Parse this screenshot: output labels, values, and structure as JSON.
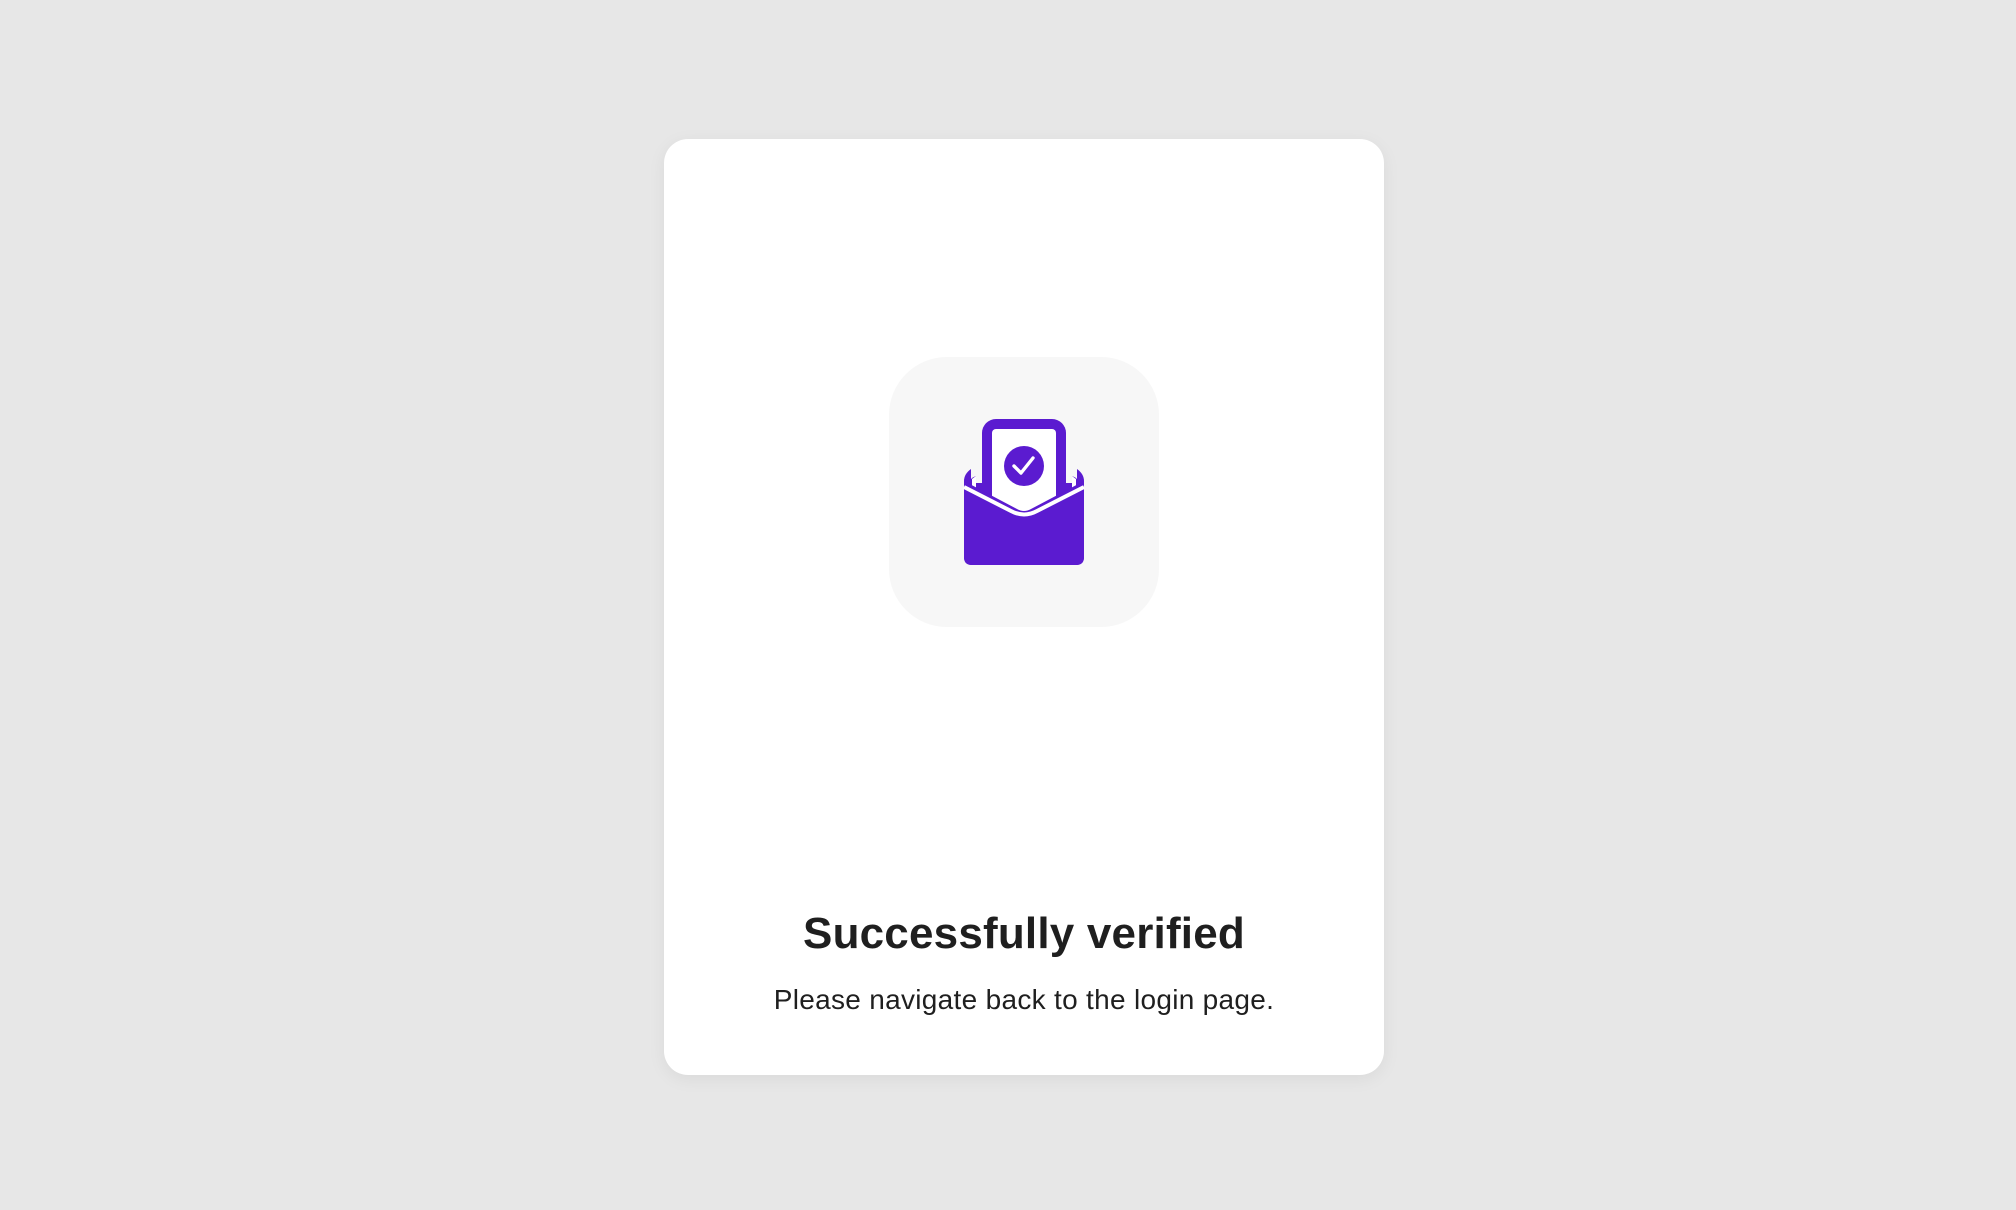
{
  "status": {
    "icon": "envelope-check-icon",
    "title": "Successfully verified",
    "message": "Please navigate back to the login page."
  },
  "colors": {
    "background": "#e7e7e7",
    "card": "#ffffff",
    "icon_tile": "#f7f7f7",
    "accent": "#5b1bd0",
    "text": "#1f1f1f"
  }
}
